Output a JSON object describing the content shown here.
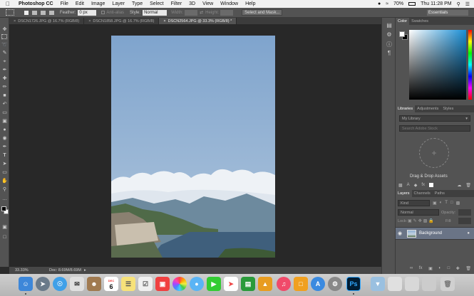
{
  "menubar": {
    "app_name": "Photoshop CC",
    "items": [
      "File",
      "Edit",
      "Image",
      "Layer",
      "Type",
      "Select",
      "Filter",
      "3D",
      "View",
      "Window",
      "Help"
    ],
    "battery": "70%",
    "clock": "Thu 11:28 PM"
  },
  "options": {
    "feather_label": "Feather:",
    "feather_value": "0 px",
    "antialias_label": "Anti-alias",
    "style_label": "Style:",
    "style_value": "Normal",
    "width_label": "Width:",
    "height_label": "Height:",
    "select_mask_label": "Select and Mask...",
    "workspace_value": "Essentials"
  },
  "tabs": [
    {
      "label": "DSCN1726.JPG @ 16.7% (RGB/8)"
    },
    {
      "label": "DSCN1858.JPG @ 16.7% (RGB/8)"
    },
    {
      "label": "DSCN2564.JPG @ 33.3% (RGB/8) *"
    }
  ],
  "status": {
    "zoom": "33.33%",
    "doc": "Doc: 8.69M/8.69M"
  },
  "color_panel": {
    "tabs": [
      "Color",
      "Swatches"
    ],
    "hue_color": "#1a8fd6"
  },
  "libraries_panel": {
    "tabs": [
      "Libraries",
      "Adjustments",
      "Styles"
    ],
    "library_select": "My Library",
    "search_placeholder": "Search Adobe Stock",
    "drop_label": "Drag & Drop Assets"
  },
  "layers_panel": {
    "tabs": [
      "Layers",
      "Channels",
      "Paths"
    ],
    "kind_label": "Kind",
    "blend_mode": "Normal",
    "opacity_label": "Opacity:",
    "lock_label": "Lock:",
    "fill_label": "Fill:",
    "layer_name": "Background"
  },
  "dock": {
    "calendar_day": "6",
    "calendar_month": "DEC",
    "photoshop_label": "Ps"
  }
}
